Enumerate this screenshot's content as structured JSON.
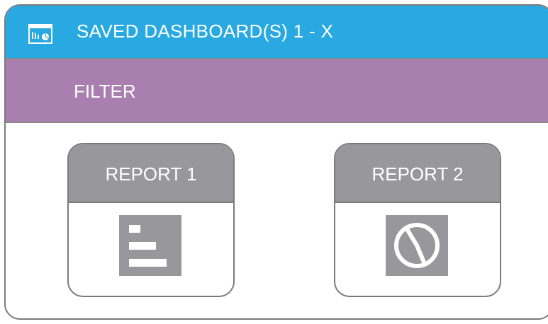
{
  "window": {
    "title": "SAVED DASHBOARD(S) 1 - X",
    "icon": "dashboard-icon"
  },
  "filter": {
    "label": "FILTER"
  },
  "reports": [
    {
      "label": "REPORT 1",
      "icon": "bar-chart-icon"
    },
    {
      "label": "REPORT 2",
      "icon": "pie-chart-icon"
    }
  ],
  "colors": {
    "title_bar": "#28a9e1",
    "filter_bar": "#a97faf",
    "card_header": "#98989c",
    "border": "#7b7b7e"
  }
}
